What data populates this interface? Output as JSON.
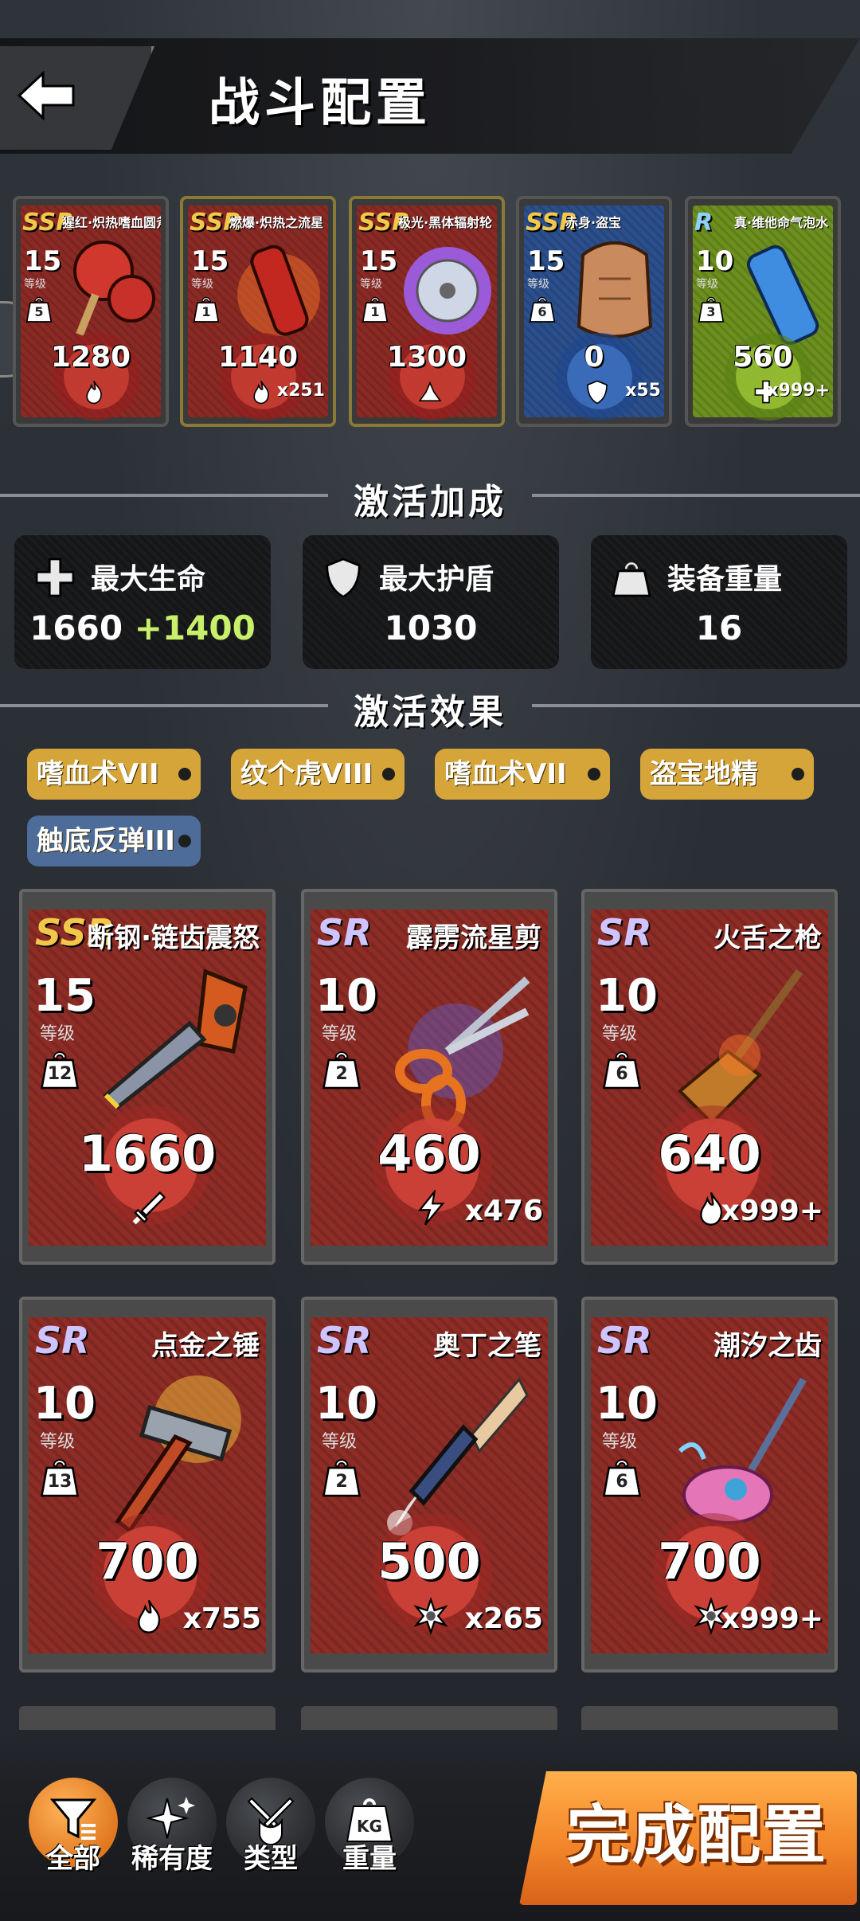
{
  "header": {
    "title": "战斗配置"
  },
  "top_cards": [
    {
      "rarity": "SSR",
      "rarity_class": "rar-ssr",
      "theme": "red",
      "name": "猩红·炽热嗜血圆斧",
      "level": "15",
      "level_label": "等级",
      "weight": "5",
      "value": "1280",
      "icon": "flame-icon",
      "count": ""
    },
    {
      "rarity": "SSR",
      "rarity_class": "rar-ssr",
      "theme": "red",
      "name": "燃爆·炽热之流星",
      "level": "15",
      "level_label": "等级",
      "weight": "1",
      "value": "1140",
      "icon": "flame-icon",
      "count": "x251"
    },
    {
      "rarity": "SSR",
      "rarity_class": "rar-ssr",
      "theme": "red",
      "name": "极光·黑体辐射轮",
      "level": "15",
      "level_label": "等级",
      "weight": "1",
      "value": "1300",
      "icon": "shock-icon",
      "count": ""
    },
    {
      "rarity": "SSR",
      "rarity_class": "rar-ssr",
      "theme": "blue",
      "name": "赤身·盗宝",
      "level": "15",
      "level_label": "等级",
      "weight": "6",
      "value": "0",
      "icon": "shield-icon",
      "count": "x55"
    },
    {
      "rarity": "R",
      "rarity_class": "rar-r",
      "theme": "green",
      "name": "真·维他命气泡水",
      "level": "10",
      "level_label": "等级",
      "weight": "3",
      "value": "560",
      "icon": "plus-icon",
      "count": "x999+"
    }
  ],
  "bonus_section": {
    "title": "激活加成"
  },
  "stats": [
    {
      "label": "最大生命",
      "value": "1660",
      "bonus": "+1400",
      "icon": "plus-icon"
    },
    {
      "label": "最大护盾",
      "value": "1030",
      "bonus": "",
      "icon": "shield-icon"
    },
    {
      "label": "装备重量",
      "value": "16",
      "bonus": "",
      "icon": "weight-icon"
    }
  ],
  "effect_section": {
    "title": "激活效果"
  },
  "tags": [
    {
      "label": "嗜血术VII",
      "color": "gold"
    },
    {
      "label": "纹个虎VIII",
      "color": "gold"
    },
    {
      "label": "嗜血术VII",
      "color": "gold"
    },
    {
      "label": "盗宝地精",
      "color": "gold"
    },
    {
      "label": "触底反弹III",
      "color": "blue"
    }
  ],
  "cards": [
    {
      "rarity": "SSR",
      "rarity_class": "rar-ssr",
      "name": "断钢·链齿震怒",
      "level": "15",
      "level_label": "等级",
      "weight": "12",
      "value": "1660",
      "icon": "sword-icon",
      "count": "",
      "art": "chainsaw"
    },
    {
      "rarity": "SR",
      "rarity_class": "rar-sr",
      "name": "霹雳流星剪",
      "level": "10",
      "level_label": "等级",
      "weight": "2",
      "value": "460",
      "icon": "lightning-icon",
      "count": "x476",
      "art": "scissors"
    },
    {
      "rarity": "SR",
      "rarity_class": "rar-sr",
      "name": "火舌之枪",
      "level": "10",
      "level_label": "等级",
      "weight": "6",
      "value": "640",
      "icon": "flame-icon",
      "count": "x999+",
      "art": "broom"
    },
    {
      "rarity": "SR",
      "rarity_class": "rar-sr",
      "name": "点金之锤",
      "level": "10",
      "level_label": "等级",
      "weight": "13",
      "value": "700",
      "icon": "flame-icon",
      "count": "x755",
      "art": "hammer"
    },
    {
      "rarity": "SR",
      "rarity_class": "rar-sr",
      "name": "奥丁之笔",
      "level": "10",
      "level_label": "等级",
      "weight": "2",
      "value": "500",
      "icon": "frost-icon",
      "count": "x265",
      "art": "pen"
    },
    {
      "rarity": "SR",
      "rarity_class": "rar-sr",
      "name": "潮汐之齿",
      "level": "10",
      "level_label": "等级",
      "weight": "6",
      "value": "700",
      "icon": "frost-icon",
      "count": "x999+",
      "art": "mop"
    }
  ],
  "filters": [
    {
      "label": "全部",
      "icon": "filter-icon",
      "active": true
    },
    {
      "label": "稀有度",
      "icon": "sparkle-icon",
      "active": false
    },
    {
      "label": "类型",
      "icon": "crossed-swords-icon",
      "active": false
    },
    {
      "label": "重量",
      "icon": "kg-weight-icon",
      "active": false
    }
  ],
  "done_button": {
    "label": "完成配置"
  },
  "colors": {
    "accent_orange": "#f3862a",
    "tag_gold": "#d6a53a",
    "tag_blue": "#4d6c99",
    "bonus_green": "#c9f06a"
  }
}
